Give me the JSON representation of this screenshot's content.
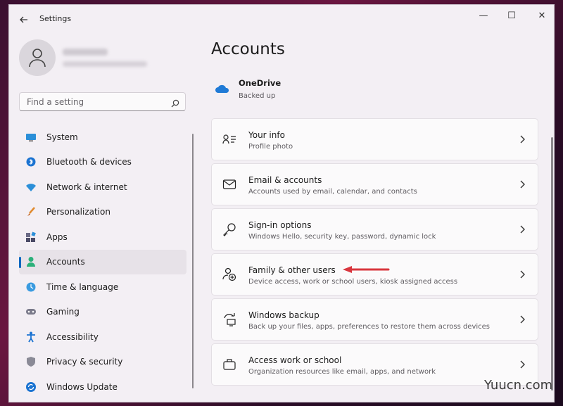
{
  "window": {
    "title": "Settings"
  },
  "titlebar": {
    "back_icon": "back-arrow-icon",
    "minimize": "—",
    "maximize": "☐",
    "close": "✕"
  },
  "search": {
    "placeholder": "Find a setting"
  },
  "sidebar": {
    "items": [
      {
        "label": "System",
        "icon": "system-icon",
        "active": false
      },
      {
        "label": "Bluetooth & devices",
        "icon": "bluetooth-icon",
        "active": false
      },
      {
        "label": "Network & internet",
        "icon": "wifi-icon",
        "active": false
      },
      {
        "label": "Personalization",
        "icon": "brush-icon",
        "active": false
      },
      {
        "label": "Apps",
        "icon": "apps-icon",
        "active": false
      },
      {
        "label": "Accounts",
        "icon": "accounts-icon",
        "active": true
      },
      {
        "label": "Time & language",
        "icon": "globe-clock-icon",
        "active": false
      },
      {
        "label": "Gaming",
        "icon": "controller-icon",
        "active": false
      },
      {
        "label": "Accessibility",
        "icon": "accessibility-icon",
        "active": false
      },
      {
        "label": "Privacy & security",
        "icon": "shield-icon",
        "active": false
      },
      {
        "label": "Windows Update",
        "icon": "update-icon",
        "active": false
      }
    ]
  },
  "main": {
    "title": "Accounts",
    "onedrive": {
      "name": "OneDrive",
      "status": "Backed up"
    },
    "cards": [
      {
        "title": "Your info",
        "subtitle": "Profile photo",
        "icon": "person-info-icon"
      },
      {
        "title": "Email & accounts",
        "subtitle": "Accounts used by email, calendar, and contacts",
        "icon": "mail-icon"
      },
      {
        "title": "Sign-in options",
        "subtitle": "Windows Hello, security key, password, dynamic lock",
        "icon": "key-icon"
      },
      {
        "title": "Family & other users",
        "subtitle": "Device access, work or school users, kiosk assigned access",
        "icon": "add-person-icon"
      },
      {
        "title": "Windows backup",
        "subtitle": "Back up your files, apps, preferences to restore them across devices",
        "icon": "backup-icon"
      },
      {
        "title": "Access work or school",
        "subtitle": "Organization resources like email, apps, and network",
        "icon": "briefcase-icon"
      }
    ]
  },
  "watermark": "Yuucn.com",
  "colors": {
    "accent": "#0067c0",
    "annotation_arrow": "#d9363e"
  }
}
